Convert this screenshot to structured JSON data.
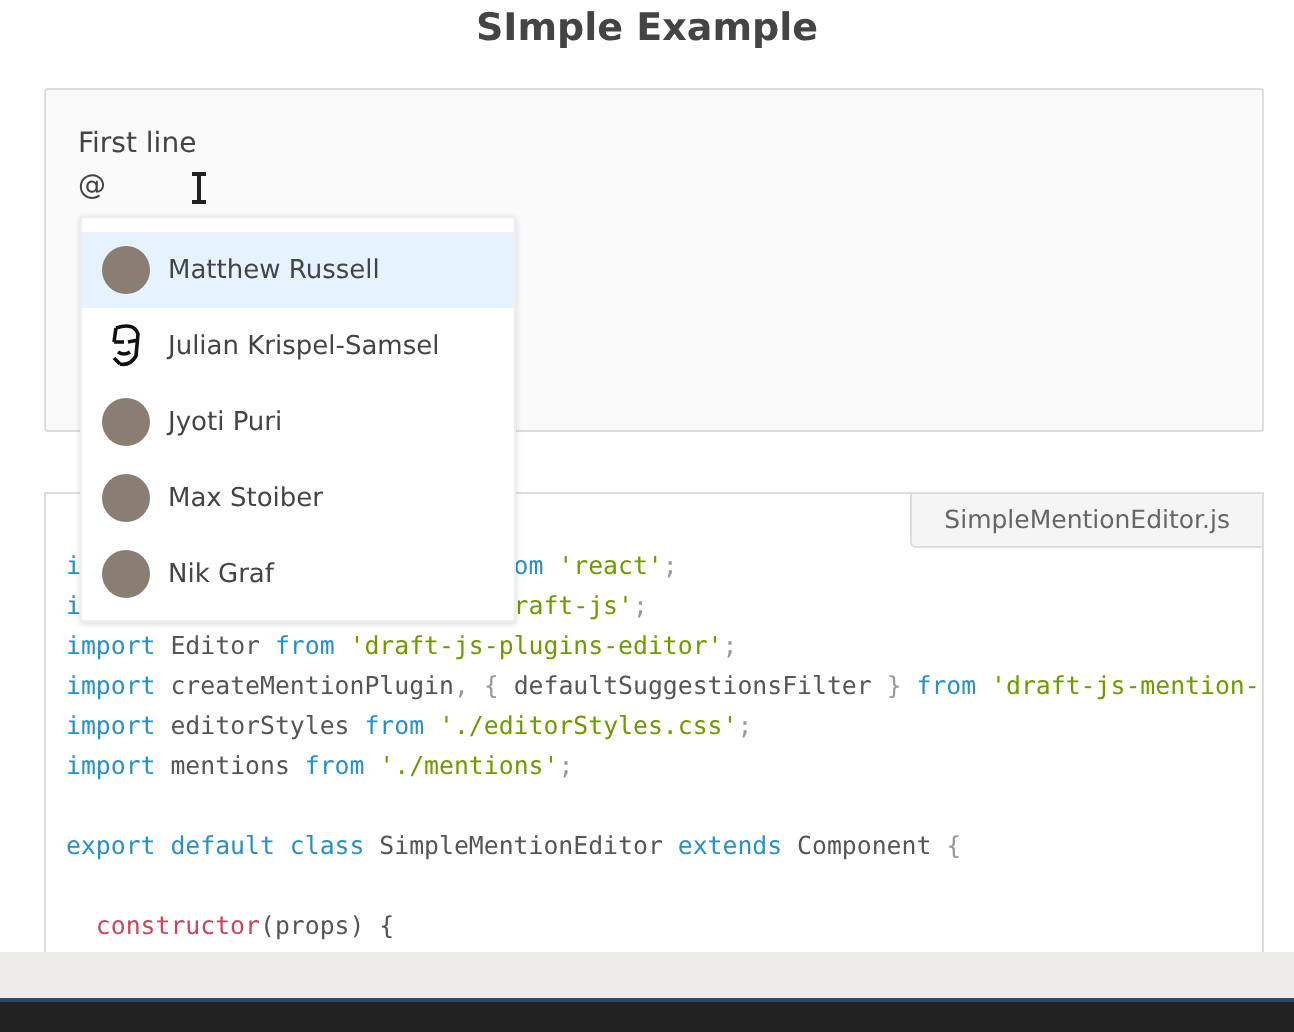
{
  "title": "SImple Example",
  "editor": {
    "lines": [
      "First line",
      "@"
    ]
  },
  "suggestions": [
    {
      "name": "Matthew Russell",
      "selected": true,
      "kind": "photo"
    },
    {
      "name": "Julian Krispel-Samsel",
      "selected": false,
      "kind": "sketch"
    },
    {
      "name": "Jyoti Puri",
      "selected": false,
      "kind": "photo"
    },
    {
      "name": "Max Stoiber",
      "selected": false,
      "kind": "photo"
    },
    {
      "name": "Nik Graf",
      "selected": false,
      "kind": "photo"
    }
  ],
  "code": {
    "file_tab": "SimpleMentionEditor.js",
    "lines": [
      {
        "tokens": [
          {
            "text": "i",
            "kind": "keyword"
          },
          {
            "text": "om",
            "kind": "keyword",
            "after_gap": true
          },
          {
            "text": " 'react'",
            "kind": "string"
          },
          {
            "text": ";",
            "kind": "punct"
          }
        ]
      },
      {
        "tokens": [
          {
            "text": "i",
            "kind": "keyword"
          },
          {
            "text": "raft-js'",
            "kind": "string",
            "after_gap": true
          },
          {
            "text": ";",
            "kind": "punct"
          }
        ]
      },
      {
        "tokens": [
          {
            "text": "import",
            "kind": "keyword"
          },
          {
            "text": " Editor ",
            "kind": "plain"
          },
          {
            "text": "from",
            "kind": "keyword"
          },
          {
            "text": " 'draft-js-plugins-editor'",
            "kind": "string"
          },
          {
            "text": ";",
            "kind": "punct"
          }
        ]
      },
      {
        "tokens": [
          {
            "text": "import",
            "kind": "keyword"
          },
          {
            "text": " createMentionPlugin",
            "kind": "plain"
          },
          {
            "text": ", { ",
            "kind": "punct"
          },
          {
            "text": "defaultSuggestionsFilter",
            "kind": "plain"
          },
          {
            "text": " } ",
            "kind": "punct"
          },
          {
            "text": "from",
            "kind": "keyword"
          },
          {
            "text": " 'draft-js-mention-",
            "kind": "string"
          }
        ]
      },
      {
        "tokens": [
          {
            "text": "import",
            "kind": "keyword"
          },
          {
            "text": " editorStyles ",
            "kind": "plain"
          },
          {
            "text": "from",
            "kind": "keyword"
          },
          {
            "text": " './editorStyles.css'",
            "kind": "string"
          },
          {
            "text": ";",
            "kind": "punct"
          }
        ]
      },
      {
        "tokens": [
          {
            "text": "import",
            "kind": "keyword"
          },
          {
            "text": " mentions ",
            "kind": "plain"
          },
          {
            "text": "from",
            "kind": "keyword"
          },
          {
            "text": " './mentions'",
            "kind": "string"
          },
          {
            "text": ";",
            "kind": "punct"
          }
        ],
        "blank_after": true
      },
      {
        "tokens": [
          {
            "text": "export default class",
            "kind": "keyword"
          },
          {
            "text": " SimpleMentionEditor ",
            "kind": "plain"
          },
          {
            "text": "extends",
            "kind": "keyword"
          },
          {
            "text": " Component ",
            "kind": "plain"
          },
          {
            "text": "{",
            "kind": "punct"
          }
        ],
        "blank_after": true
      },
      {
        "tokens": [
          {
            "text": "  constructor",
            "kind": "function"
          },
          {
            "text": "(props) {",
            "kind": "plain"
          }
        ]
      }
    ]
  }
}
